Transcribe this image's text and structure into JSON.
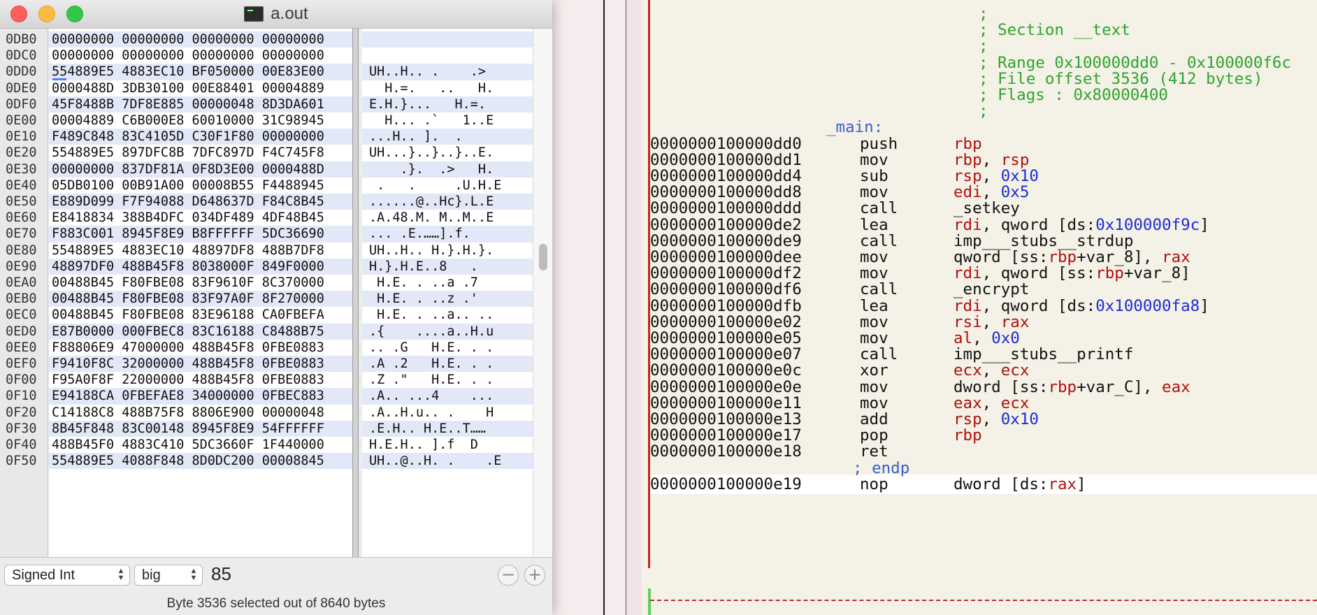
{
  "hexfiend": {
    "title": "a.out",
    "rows": [
      {
        "offset": "0DB0",
        "hex": "00000000 00000000 00000000 00000000",
        "ascii": ""
      },
      {
        "offset": "0DC0",
        "hex": "00000000 00000000 00000000 00000000",
        "ascii": ""
      },
      {
        "offset": "0DD0",
        "hex": "554889E5 4883EC10 BF050000 00E83E00",
        "ascii": "UH..H.. .    .>"
      },
      {
        "offset": "0DE0",
        "hex": "0000488D 3DB30100 00E88401 00004889",
        "ascii": "  H.=.   ..   H."
      },
      {
        "offset": "0DF0",
        "hex": "45F8488B 7DF8E885 00000048 8D3DA601",
        "ascii": "E.H.}...   H.=."
      },
      {
        "offset": "0E00",
        "hex": "00004889 C6B000E8 60010000 31C98945",
        "ascii": "  H... .`   1..E"
      },
      {
        "offset": "0E10",
        "hex": "F489C848 83C4105D C30F1F80 00000000",
        "ascii": "...H.. ].  ."
      },
      {
        "offset": "0E20",
        "hex": "554889E5 897DFC8B 7DFC897D F4C745F8",
        "ascii": "UH...}..}..}..E."
      },
      {
        "offset": "0E30",
        "hex": "00000000 837DF81A 0F8D3E00 0000488D",
        "ascii": "    .}.  .>   H."
      },
      {
        "offset": "0E40",
        "hex": "05DB0100 00B91A00 00008B55 F4488945",
        "ascii": " .   .     .U.H.E"
      },
      {
        "offset": "0E50",
        "hex": "E889D099 F7F94088 D648637D F84C8B45",
        "ascii": "......@..Hc}.L.E"
      },
      {
        "offset": "0E60",
        "hex": "E8418834 388B4DFC 034DF489 4DF48B45",
        "ascii": ".A.48.M. M..M..E"
      },
      {
        "offset": "0E70",
        "hex": "F883C001 8945F8E9 B8FFFFFF 5DC36690",
        "ascii": "... .E.……].f."
      },
      {
        "offset": "0E80",
        "hex": "554889E5 4883EC10 48897DF8 488B7DF8",
        "ascii": "UH..H.. H.}.H.}."
      },
      {
        "offset": "0E90",
        "hex": "48897DF0 488B45F8 8038000F 849F0000",
        "ascii": "H.}.H.E..8   ."
      },
      {
        "offset": "0EA0",
        "hex": "00488B45 F80FBE08 83F9610F 8C370000",
        "ascii": " H.E. . ..a .7"
      },
      {
        "offset": "0EB0",
        "hex": "00488B45 F80FBE08 83F97A0F 8F270000",
        "ascii": " H.E. . ..z .'"
      },
      {
        "offset": "0EC0",
        "hex": "00488B45 F80FBE08 83E96188 CA0FBEFA",
        "ascii": " H.E. . ..a.. .."
      },
      {
        "offset": "0ED0",
        "hex": "E87B0000 000FBEC8 83C16188 C8488B75",
        "ascii": ".{    ....a..H.u"
      },
      {
        "offset": "0EE0",
        "hex": "F88806E9 47000000 488B45F8 0FBE0883",
        "ascii": ".. .G   H.E. . ."
      },
      {
        "offset": "0EF0",
        "hex": "F9410F8C 32000000 488B45F8 0FBE0883",
        "ascii": ".A .2   H.E. . ."
      },
      {
        "offset": "0F00",
        "hex": "F95A0F8F 22000000 488B45F8 0FBE0883",
        "ascii": ".Z .\"   H.E. . ."
      },
      {
        "offset": "0F10",
        "hex": "E94188CA 0FBEFAE8 34000000 0FBEC883",
        "ascii": ".A.. ...4    ..."
      },
      {
        "offset": "0F20",
        "hex": "C14188C8 488B75F8 8806E900 00000048",
        "ascii": ".A..H.u.. .    H"
      },
      {
        "offset": "0F30",
        "hex": "8B45F848 83C00148 8945F8E9 54FFFFFF",
        "ascii": ".E.H.. H.E..T……"
      },
      {
        "offset": "0F40",
        "hex": "488B45F0 4883C410 5DC3660F 1F440000",
        "ascii": "H.E.H.. ].f  D"
      },
      {
        "offset": "0F50",
        "hex": "554889E5 4088F848 8D0DC200 00008845",
        "ascii": "UH..@..H. .    .E"
      }
    ],
    "type_popup": "Signed Int",
    "endian_popup": "big",
    "value": "85",
    "minus": "−",
    "plus": "+",
    "status": "Byte 3536 selected out of 8640 bytes"
  },
  "disasm": {
    "comments": [
      ";",
      "; Section __text",
      ";",
      "; Range 0x100000dd0 - 0x100000f6c",
      "; File offset 3536 (412 bytes)",
      "; Flags : 0x80000400",
      ";"
    ],
    "label": "_main:",
    "endp": "; endp",
    "lines": [
      {
        "addr": "0000000100000dd0",
        "mn": "push",
        "ops": [
          {
            "t": "rbp",
            "c": "reg"
          }
        ]
      },
      {
        "addr": "0000000100000dd1",
        "mn": "mov",
        "ops": [
          {
            "t": "rbp",
            "c": "reg"
          },
          {
            "t": ", "
          },
          {
            "t": "rsp",
            "c": "reg"
          }
        ]
      },
      {
        "addr": "0000000100000dd4",
        "mn": "sub",
        "ops": [
          {
            "t": "rsp",
            "c": "reg"
          },
          {
            "t": ", "
          },
          {
            "t": "0x10",
            "c": "num"
          }
        ]
      },
      {
        "addr": "0000000100000dd8",
        "mn": "mov",
        "ops": [
          {
            "t": "edi",
            "c": "reg"
          },
          {
            "t": ", "
          },
          {
            "t": "0x5",
            "c": "num"
          }
        ]
      },
      {
        "addr": "0000000100000ddd",
        "mn": "call",
        "ops": [
          {
            "t": "_setkey"
          }
        ]
      },
      {
        "addr": "0000000100000de2",
        "mn": "lea",
        "ops": [
          {
            "t": "rdi",
            "c": "reg"
          },
          {
            "t": ", qword [ds:"
          },
          {
            "t": "0x100000f9c",
            "c": "num"
          },
          {
            "t": "]"
          }
        ]
      },
      {
        "addr": "0000000100000de9",
        "mn": "call",
        "ops": [
          {
            "t": "imp___stubs__strdup"
          }
        ]
      },
      {
        "addr": "0000000100000dee",
        "mn": "mov",
        "ops": [
          {
            "t": "qword [ss:"
          },
          {
            "t": "rbp",
            "c": "reg"
          },
          {
            "t": "+var_8], "
          },
          {
            "t": "rax",
            "c": "reg"
          }
        ]
      },
      {
        "addr": "0000000100000df2",
        "mn": "mov",
        "ops": [
          {
            "t": "rdi",
            "c": "reg"
          },
          {
            "t": ", qword [ss:"
          },
          {
            "t": "rbp",
            "c": "reg"
          },
          {
            "t": "+var_8]"
          }
        ]
      },
      {
        "addr": "0000000100000df6",
        "mn": "call",
        "ops": [
          {
            "t": "_encrypt"
          }
        ]
      },
      {
        "addr": "0000000100000dfb",
        "mn": "lea",
        "ops": [
          {
            "t": "rdi",
            "c": "reg"
          },
          {
            "t": ", qword [ds:"
          },
          {
            "t": "0x100000fa8",
            "c": "num"
          },
          {
            "t": "]"
          }
        ]
      },
      {
        "addr": "0000000100000e02",
        "mn": "mov",
        "ops": [
          {
            "t": "rsi",
            "c": "reg"
          },
          {
            "t": ", "
          },
          {
            "t": "rax",
            "c": "reg"
          }
        ]
      },
      {
        "addr": "0000000100000e05",
        "mn": "mov",
        "ops": [
          {
            "t": "al",
            "c": "reg"
          },
          {
            "t": ", "
          },
          {
            "t": "0x0",
            "c": "num"
          }
        ]
      },
      {
        "addr": "0000000100000e07",
        "mn": "call",
        "ops": [
          {
            "t": "imp___stubs__printf"
          }
        ]
      },
      {
        "addr": "0000000100000e0c",
        "mn": "xor",
        "ops": [
          {
            "t": "ecx",
            "c": "reg"
          },
          {
            "t": ", "
          },
          {
            "t": "ecx",
            "c": "reg"
          }
        ]
      },
      {
        "addr": "0000000100000e0e",
        "mn": "mov",
        "ops": [
          {
            "t": "dword [ss:"
          },
          {
            "t": "rbp",
            "c": "reg"
          },
          {
            "t": "+var_C], "
          },
          {
            "t": "eax",
            "c": "reg"
          }
        ]
      },
      {
        "addr": "0000000100000e11",
        "mn": "mov",
        "ops": [
          {
            "t": "eax",
            "c": "reg"
          },
          {
            "t": ", "
          },
          {
            "t": "ecx",
            "c": "reg"
          }
        ]
      },
      {
        "addr": "0000000100000e13",
        "mn": "add",
        "ops": [
          {
            "t": "rsp",
            "c": "reg"
          },
          {
            "t": ", "
          },
          {
            "t": "0x10",
            "c": "num"
          }
        ]
      },
      {
        "addr": "0000000100000e17",
        "mn": "pop",
        "ops": [
          {
            "t": "rbp",
            "c": "reg"
          }
        ]
      },
      {
        "addr": "0000000100000e18",
        "mn": "ret",
        "ops": []
      }
    ],
    "after": {
      "addr": "0000000100000e19",
      "mn": "nop",
      "ops": [
        {
          "t": "dword [ds:"
        },
        {
          "t": "rax",
          "c": "reg"
        },
        {
          "t": "]"
        }
      ]
    },
    "colors": {
      "comment": "#2ea42e",
      "label": "#3a5fc8",
      "register": "#b01010",
      "number": "#1d2bd6",
      "background": "#f4f1e6"
    }
  }
}
